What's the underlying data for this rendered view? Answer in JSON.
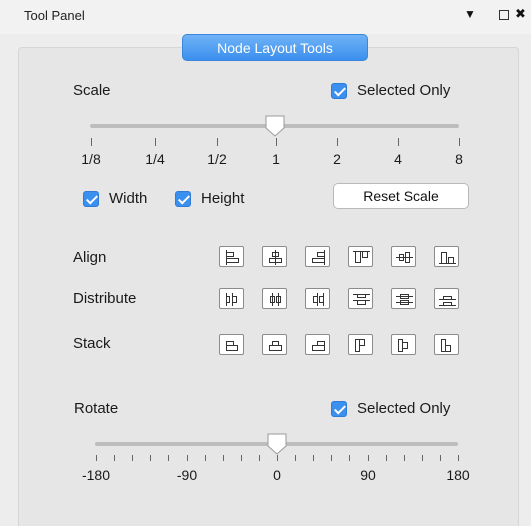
{
  "window": {
    "title": "Tool Panel",
    "menu_glyph": "▼",
    "close_glyph": "✖"
  },
  "tab": {
    "label": "Node Layout Tools"
  },
  "scale": {
    "label": "Scale",
    "selected_only_label": "Selected Only",
    "selected_only_checked": true,
    "ticks": [
      "1/8",
      "1/4",
      "1/2",
      "1",
      "2",
      "4",
      "8"
    ],
    "value": "1",
    "width_label": "Width",
    "width_checked": true,
    "height_label": "Height",
    "height_checked": true,
    "reset_label": "Reset Scale"
  },
  "rows": [
    {
      "label": "Align",
      "icons": [
        "align-left-icon",
        "align-center-horizontal-icon",
        "align-right-icon",
        "align-top-icon",
        "align-center-vertical-icon",
        "align-bottom-icon"
      ]
    },
    {
      "label": "Distribute",
      "icons": [
        "distribute-left-icon",
        "distribute-center-horizontal-icon",
        "distribute-right-icon",
        "distribute-top-icon",
        "distribute-center-vertical-icon",
        "distribute-bottom-icon"
      ]
    },
    {
      "label": "Stack",
      "icons": [
        "stack-left-icon",
        "stack-center-icon",
        "stack-right-icon",
        "stack-top-icon",
        "stack-middle-icon",
        "stack-bottom-icon"
      ]
    }
  ],
  "rotate": {
    "label": "Rotate",
    "selected_only_label": "Selected Only",
    "selected_only_checked": true,
    "ticks": [
      "-180",
      "-90",
      "0",
      "90",
      "180"
    ],
    "value": 0
  },
  "colors": {
    "accent": "#3b8fee",
    "panel": "#e6e6e6",
    "background": "#ededed"
  }
}
